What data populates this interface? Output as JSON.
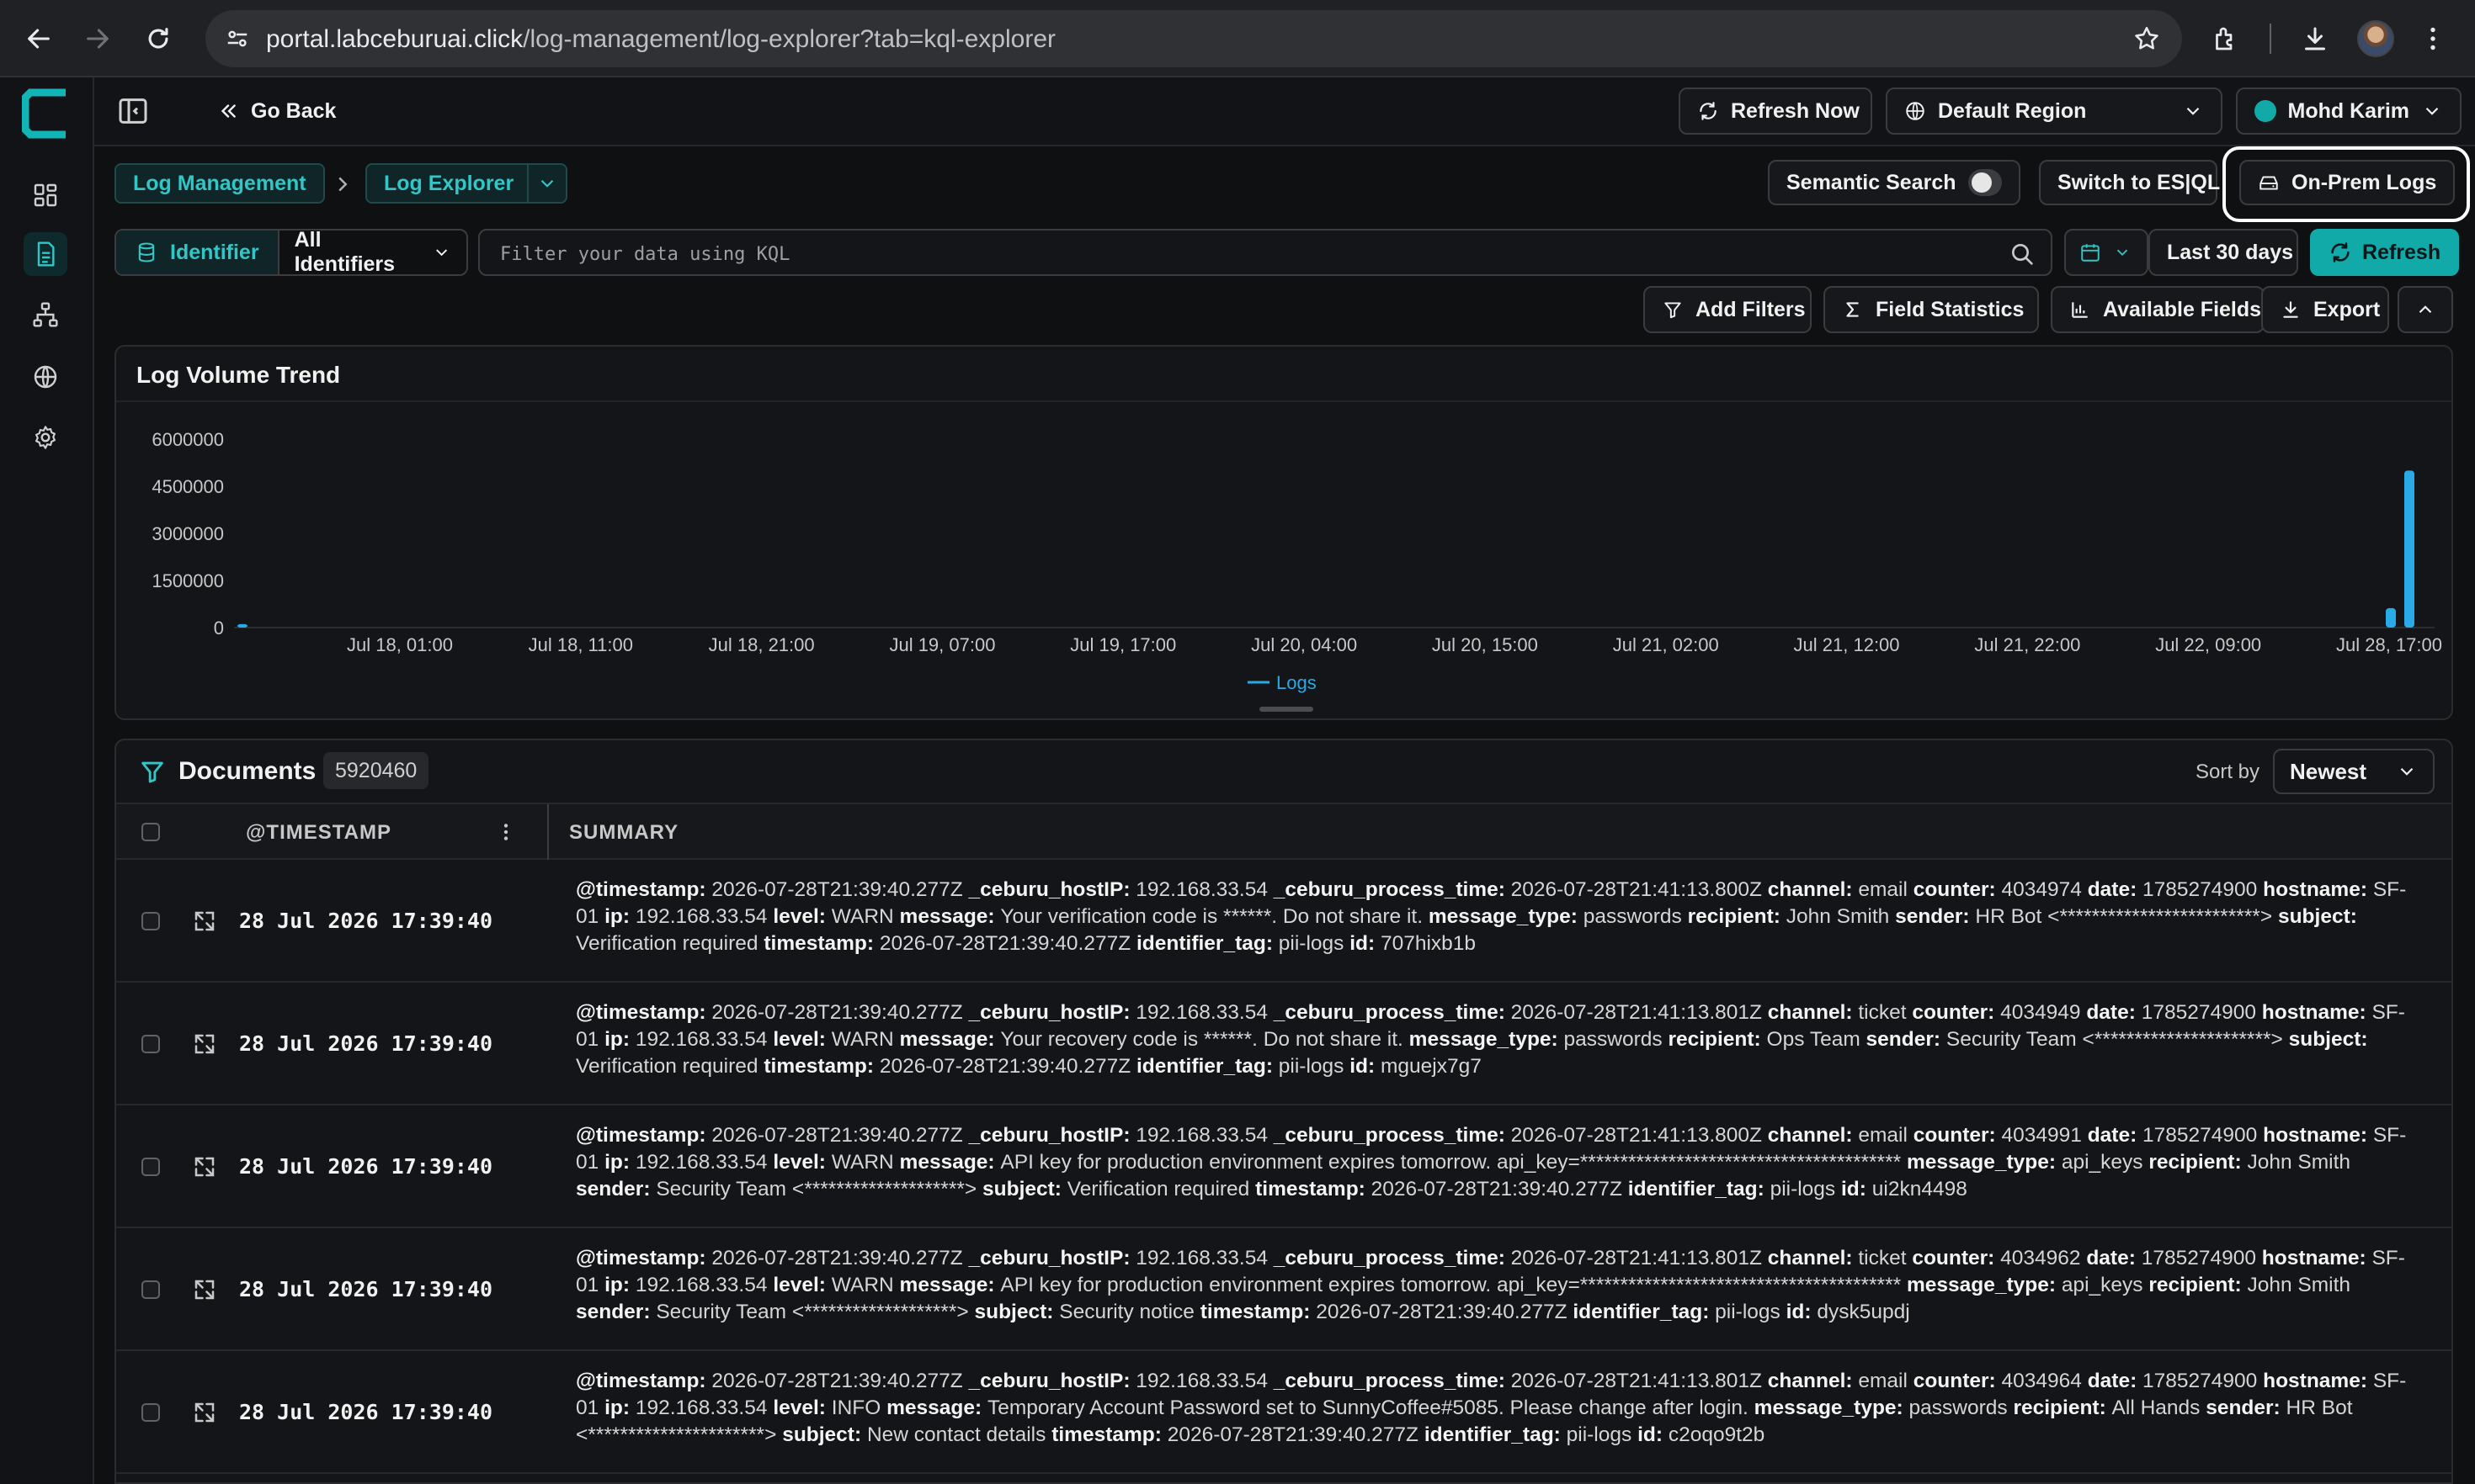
{
  "browser": {
    "url_host": "portal.labceburuai.click",
    "url_path": "/log-management/log-explorer?tab=kql-explorer"
  },
  "topbar": {
    "go_back": "Go Back",
    "refresh_now": "Refresh Now",
    "region": "Default Region",
    "user": "Mohd Karim"
  },
  "breadcrumb": {
    "root": "Log Management",
    "current": "Log Explorer"
  },
  "actions": {
    "semantic_search": "Semantic Search",
    "semantic_search_on": false,
    "switch_esql": "Switch to ES|QL",
    "on_prem": "On-Prem Logs"
  },
  "filter": {
    "identifier_label": "Identifier",
    "identifier_value": "All Identifiers",
    "kql_placeholder": "Filter your data using KQL",
    "date_range": "Last 30 days",
    "refresh": "Refresh"
  },
  "toolbar": {
    "add_filters": "Add Filters",
    "field_statistics": "Field Statistics",
    "available_fields": "Available Fields",
    "export": "Export"
  },
  "chart": {
    "title": "Log Volume Trend",
    "legend": "Logs"
  },
  "chart_data": {
    "type": "bar",
    "title": "Log Volume Trend",
    "ylim": [
      0,
      6000000
    ],
    "y_ticks": [
      "6000000",
      "4500000",
      "3000000",
      "1500000",
      "0"
    ],
    "x_ticks": [
      "Jul 18, 01:00",
      "Jul 18, 11:00",
      "Jul 18, 21:00",
      "Jul 19, 07:00",
      "Jul 19, 17:00",
      "Jul 20, 04:00",
      "Jul 20, 15:00",
      "Jul 21, 02:00",
      "Jul 21, 12:00",
      "Jul 21, 22:00",
      "Jul 22, 09:00",
      "Jul 28, 17:00"
    ],
    "series": [
      {
        "name": "Logs",
        "color": "#29a9e6",
        "points": [
          {
            "x": "Jul 18, 00:00",
            "y": 110000
          },
          {
            "x": "Jul 28, 16:00",
            "y": 620000
          },
          {
            "x": "Jul 28, 17:00",
            "y": 5000000
          }
        ]
      }
    ],
    "legend_position": "bottom-center",
    "grid": false
  },
  "documents": {
    "title": "Documents",
    "count": "5920460",
    "sort_label": "Sort by",
    "sort_value": "Newest",
    "col_timestamp": "@TIMESTAMP",
    "col_summary": "SUMMARY",
    "rows": [
      {
        "time": "28 Jul 2026 17:39:40",
        "fields": [
          [
            "@timestamp:",
            "2026-07-28T21:39:40.277Z"
          ],
          [
            "_ceburu_hostIP:",
            "192.168.33.54"
          ],
          [
            "_ceburu_process_time:",
            "2026-07-28T21:41:13.800Z"
          ],
          [
            "channel:",
            "email"
          ],
          [
            "counter:",
            "4034974"
          ],
          [
            "date:",
            "1785274900"
          ],
          [
            "hostname:",
            "SF-01"
          ],
          [
            "ip:",
            "192.168.33.54"
          ],
          [
            "level:",
            "WARN"
          ],
          [
            "message:",
            "Your verification code is ******. Do not share it."
          ],
          [
            "message_type:",
            "passwords"
          ],
          [
            "recipient:",
            "John Smith"
          ],
          [
            "sender:",
            "HR Bot <*************************>"
          ],
          [
            "subject:",
            "Verification required"
          ],
          [
            "timestamp:",
            "2026-07-28T21:39:40.277Z"
          ],
          [
            "identifier_tag:",
            "pii-logs"
          ],
          [
            "id:",
            "707hixb1b"
          ]
        ]
      },
      {
        "time": "28 Jul 2026 17:39:40",
        "fields": [
          [
            "@timestamp:",
            "2026-07-28T21:39:40.277Z"
          ],
          [
            "_ceburu_hostIP:",
            "192.168.33.54"
          ],
          [
            "_ceburu_process_time:",
            "2026-07-28T21:41:13.801Z"
          ],
          [
            "channel:",
            "ticket"
          ],
          [
            "counter:",
            "4034949"
          ],
          [
            "date:",
            "1785274900"
          ],
          [
            "hostname:",
            "SF-01"
          ],
          [
            "ip:",
            "192.168.33.54"
          ],
          [
            "level:",
            "WARN"
          ],
          [
            "message:",
            "Your recovery code is ******. Do not share it."
          ],
          [
            "message_type:",
            "passwords"
          ],
          [
            "recipient:",
            "Ops Team"
          ],
          [
            "sender:",
            "Security Team <**********************>"
          ],
          [
            "subject:",
            "Verification required"
          ],
          [
            "timestamp:",
            "2026-07-28T21:39:40.277Z"
          ],
          [
            "identifier_tag:",
            "pii-logs"
          ],
          [
            "id:",
            "mguejx7g7"
          ]
        ]
      },
      {
        "time": "28 Jul 2026 17:39:40",
        "fields": [
          [
            "@timestamp:",
            "2026-07-28T21:39:40.277Z"
          ],
          [
            "_ceburu_hostIP:",
            "192.168.33.54"
          ],
          [
            "_ceburu_process_time:",
            "2026-07-28T21:41:13.800Z"
          ],
          [
            "channel:",
            "email"
          ],
          [
            "counter:",
            "4034991"
          ],
          [
            "date:",
            "1785274900"
          ],
          [
            "hostname:",
            "SF-01"
          ],
          [
            "ip:",
            "192.168.33.54"
          ],
          [
            "level:",
            "WARN"
          ],
          [
            "message:",
            "API key for production environment expires tomorrow. api_key=****************************************"
          ],
          [
            "message_type:",
            "api_keys"
          ],
          [
            "recipient:",
            "John Smith"
          ],
          [
            "sender:",
            "Security Team <********************>"
          ],
          [
            "subject:",
            "Verification required"
          ],
          [
            "timestamp:",
            "2026-07-28T21:39:40.277Z"
          ],
          [
            "identifier_tag:",
            "pii-logs"
          ],
          [
            "id:",
            "ui2kn4498"
          ]
        ]
      },
      {
        "time": "28 Jul 2026 17:39:40",
        "fields": [
          [
            "@timestamp:",
            "2026-07-28T21:39:40.277Z"
          ],
          [
            "_ceburu_hostIP:",
            "192.168.33.54"
          ],
          [
            "_ceburu_process_time:",
            "2026-07-28T21:41:13.801Z"
          ],
          [
            "channel:",
            "ticket"
          ],
          [
            "counter:",
            "4034962"
          ],
          [
            "date:",
            "1785274900"
          ],
          [
            "hostname:",
            "SF-01"
          ],
          [
            "ip:",
            "192.168.33.54"
          ],
          [
            "level:",
            "WARN"
          ],
          [
            "message:",
            "API key for production environment expires tomorrow. api_key=****************************************"
          ],
          [
            "message_type:",
            "api_keys"
          ],
          [
            "recipient:",
            "John Smith"
          ],
          [
            "sender:",
            "Security Team <*******************>"
          ],
          [
            "subject:",
            "Security notice"
          ],
          [
            "timestamp:",
            "2026-07-28T21:39:40.277Z"
          ],
          [
            "identifier_tag:",
            "pii-logs"
          ],
          [
            "id:",
            "dysk5updj"
          ]
        ]
      },
      {
        "time": "28 Jul 2026 17:39:40",
        "fields": [
          [
            "@timestamp:",
            "2026-07-28T21:39:40.277Z"
          ],
          [
            "_ceburu_hostIP:",
            "192.168.33.54"
          ],
          [
            "_ceburu_process_time:",
            "2026-07-28T21:41:13.801Z"
          ],
          [
            "channel:",
            "email"
          ],
          [
            "counter:",
            "4034964"
          ],
          [
            "date:",
            "1785274900"
          ],
          [
            "hostname:",
            "SF-01"
          ],
          [
            "ip:",
            "192.168.33.54"
          ],
          [
            "level:",
            "INFO"
          ],
          [
            "message:",
            "Temporary Account Password set to SunnyCoffee#5085. Please change after login."
          ],
          [
            "message_type:",
            "passwords"
          ],
          [
            "recipient:",
            "All Hands"
          ],
          [
            "sender:",
            "HR Bot <**********************>"
          ],
          [
            "subject:",
            "New contact details"
          ],
          [
            "timestamp:",
            "2026-07-28T21:39:40.277Z"
          ],
          [
            "identifier_tag:",
            "pii-logs"
          ],
          [
            "id:",
            "c2oqo9t2b"
          ]
        ]
      }
    ]
  },
  "colors": {
    "accent": "#12a9a9",
    "bar": "#29a9e6",
    "background": "#0f1012"
  }
}
